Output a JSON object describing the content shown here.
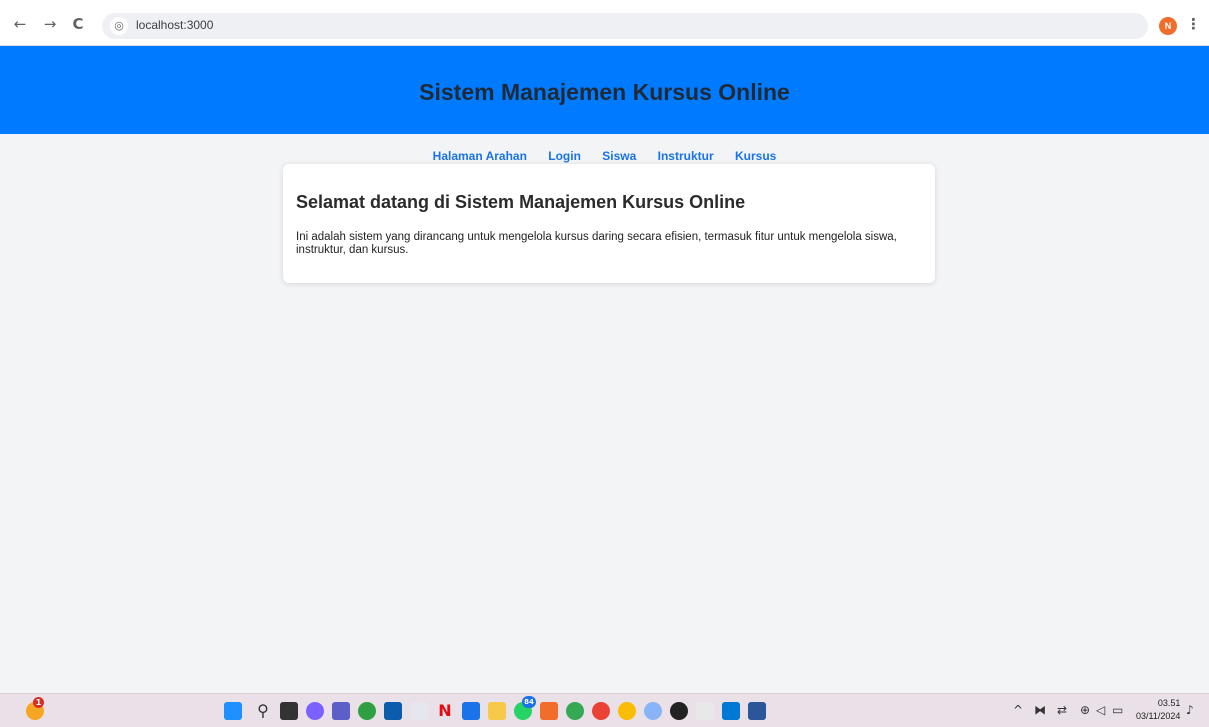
{
  "browser": {
    "back_icon": "←",
    "forward_icon": "→",
    "reload_icon": "C",
    "site_icon": "◎",
    "url": "localhost:3000",
    "profile_initial": "N",
    "menu_icon": "⋮"
  },
  "header": {
    "title": "Sistem Manajemen Kursus Online"
  },
  "nav": {
    "items": [
      "Halaman Arahan",
      "Login",
      "Siswa",
      "Instruktur",
      "Kursus"
    ]
  },
  "card": {
    "title": "Selamat datang di Sistem Manajemen Kursus Online",
    "text": "Ini adalah sistem yang dirancang untuk mengelola kursus daring secara efisien, termasuk fitur untuk mengelola siswa, instruktur, dan kursus."
  },
  "taskbar": {
    "notification_badge": "1",
    "whatsapp_badge": "84",
    "clock_time": "03.51",
    "clock_date": "03/11/2024",
    "colors": {
      "start": "#1e90ff",
      "netflix": "#e50914",
      "vscode": "#0078d4",
      "word": "#2b579a"
    }
  },
  "theme": {
    "header_bg": "#007bff",
    "nav_link": "#1a73e8",
    "page_bg": "#f3f4f6"
  }
}
